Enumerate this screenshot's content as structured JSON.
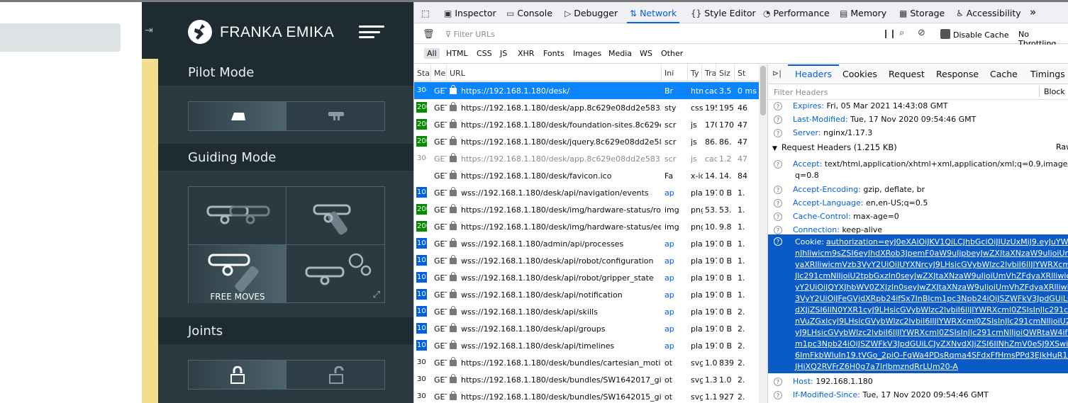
{
  "brand": {
    "name": "FRANKA EMIKA"
  },
  "desk": {
    "sections": [
      {
        "title": "Pilot Mode"
      },
      {
        "title": "Guiding Mode"
      },
      {
        "title": "Joints"
      }
    ],
    "guiding": {
      "selected_label": "FREE MOVES"
    }
  },
  "devtools": {
    "tabs": [
      {
        "label": "Inspector",
        "icon": "inspector-icon"
      },
      {
        "label": "Console",
        "icon": "console-icon"
      },
      {
        "label": "Debugger",
        "icon": "debugger-icon"
      },
      {
        "label": "Network",
        "icon": "network-icon"
      },
      {
        "label": "Style Editor",
        "icon": "style-editor-icon"
      },
      {
        "label": "Performance",
        "icon": "performance-icon"
      },
      {
        "label": "Memory",
        "icon": "memory-icon"
      },
      {
        "label": "Storage",
        "icon": "storage-icon"
      },
      {
        "label": "Accessibility",
        "icon": "accessibility-icon"
      }
    ],
    "active_tab": "Network",
    "filter_placeholder": "Filter URLs",
    "disable_cache": "Disable Cache",
    "throttling": "No Throttling",
    "types": [
      "All",
      "HTML",
      "CSS",
      "JS",
      "XHR",
      "Fonts",
      "Images",
      "Media",
      "WS",
      "Other"
    ],
    "columns": [
      "Sta",
      "Me",
      "URL",
      "Ini",
      "Ty",
      "Tra",
      "Siz",
      "St"
    ],
    "requests": [
      {
        "status": "304",
        "method": "GET",
        "url": "https://192.168.1.180/desk/",
        "init": "Br",
        "type": "htm",
        "transfer": "cac",
        "size": "3.5",
        "time": "0 ms"
      },
      {
        "status": "200",
        "method": "GET",
        "url": "https://192.168.1.180/desk/app.8c629e08dd2e58329...",
        "init": "sty",
        "type": "css",
        "transfer": "195",
        "size": "195",
        "time": "46"
      },
      {
        "status": "200",
        "method": "GET",
        "url": "https://192.168.1.180/desk/foundation-sites.8c629e0...",
        "init": "scr",
        "type": "js",
        "transfer": "170",
        "size": "170",
        "time": "47"
      },
      {
        "status": "200",
        "method": "GET",
        "url": "https://192.168.1.180/desk/jquery.8c629e08dd2e583...",
        "init": "scr",
        "type": "js",
        "transfer": "86.",
        "size": "86.",
        "time": "47"
      },
      {
        "status": "304",
        "method": "GET",
        "url": "https://192.168.1.180/desk/app.8c629e08dd2e58329...",
        "init": "scr",
        "type": "js",
        "transfer": "cac",
        "size": "1.2",
        "time": "47"
      },
      {
        "status": "",
        "method": "GET",
        "url": "https://192.168.1.180/desk/favicon.ico",
        "init": "Fa",
        "type": "x-ic",
        "transfer": "14.",
        "size": "14.",
        "time": "84"
      },
      {
        "status": "101",
        "method": "GET",
        "url": "wss://192.168.1.180/desk/api/navigation/events",
        "init": "ap",
        "type": "pla",
        "transfer": "197",
        "size": "0 B",
        "time": "1."
      },
      {
        "status": "200",
        "method": "GET",
        "url": "https://192.168.1.180/desk/img/hardware-status/rob...",
        "init": "img",
        "type": "png",
        "transfer": "53.",
        "size": "53.",
        "time": "1."
      },
      {
        "status": "200",
        "method": "GET",
        "url": "https://192.168.1.180/desk/img/hardware-status/ee-...",
        "init": "img",
        "type": "png",
        "transfer": "10.",
        "size": "9.8",
        "time": "1."
      },
      {
        "status": "101",
        "method": "GET",
        "url": "wss://192.168.1.180/admin/api/processes",
        "init": "ap",
        "type": "pla",
        "transfer": "197",
        "size": "0 B",
        "time": "1."
      },
      {
        "status": "101",
        "method": "GET",
        "url": "wss://192.168.1.180/desk/api/robot/configuration",
        "init": "ap",
        "type": "pla",
        "transfer": "197",
        "size": "0 B",
        "time": "1."
      },
      {
        "status": "101",
        "method": "GET",
        "url": "wss://192.168.1.180/desk/api/robot/gripper_state",
        "init": "ap",
        "type": "pla",
        "transfer": "197",
        "size": "0 B",
        "time": "1."
      },
      {
        "status": "101",
        "method": "GET",
        "url": "wss://192.168.1.180/desk/api/notification",
        "init": "ap",
        "type": "pla",
        "transfer": "197",
        "size": "0 B",
        "time": "1."
      },
      {
        "status": "101",
        "method": "GET",
        "url": "wss://192.168.1.180/desk/api/skills",
        "init": "ap",
        "type": "pla",
        "transfer": "197",
        "size": "0 B",
        "time": "2."
      },
      {
        "status": "101",
        "method": "GET",
        "url": "wss://192.168.1.180/desk/api/groups",
        "init": "ap",
        "type": "pla",
        "transfer": "197",
        "size": "0 B",
        "time": "2."
      },
      {
        "status": "101",
        "method": "GET",
        "url": "wss://192.168.1.180/desk/api/timelines",
        "init": "ap",
        "type": "pla",
        "transfer": "197",
        "size": "0 B",
        "time": "2."
      },
      {
        "status": "307",
        "method": "GET",
        "url": "https://192.168.1.180/desk/bundles/cartesian_motio...",
        "init": "ot",
        "type": "svg",
        "transfer": "1.0",
        "size": "839",
        "time": "2."
      },
      {
        "status": "307",
        "method": "GET",
        "url": "https://192.168.1.180/desk/bundles/SW1642017_gim...",
        "init": "ot",
        "type": "svg",
        "transfer": "1.3",
        "size": "1.0",
        "time": "2."
      },
      {
        "status": "307",
        "method": "GET",
        "url": "https://192.168.1.180/desk/bundles/SW1642015_gim...",
        "init": "ot",
        "type": "svg",
        "transfer": "1.1",
        "size": "927",
        "time": "2."
      }
    ],
    "panel_tabs": [
      "Headers",
      "Cookies",
      "Request",
      "Response",
      "Cache",
      "Timings"
    ],
    "filter_headers": "Filter Headers",
    "block": "Block",
    "raw": "Raw",
    "response_headers": [
      {
        "key": "Expires:",
        "value": "Fri, 05 Mar 2021 14:43:08 GMT"
      },
      {
        "key": "Last-Modified:",
        "value": "Tue, 17 Nov 2020 09:54:46 GMT"
      },
      {
        "key": "Server:",
        "value": "nginx/1.17.3"
      }
    ],
    "request_headers_title": "Request Headers (1.215 KB)",
    "request_headers": [
      {
        "key": "Accept:",
        "value": "text/html,application/xhtml+xml,application/xml;q=0.9,image/webp,",
        "cont": "q=0.8"
      },
      {
        "key": "Accept-Encoding:",
        "value": "gzip, deflate, br"
      },
      {
        "key": "Accept-Language:",
        "value": "en,en-US;q=0.5"
      },
      {
        "key": "Cache-Control:",
        "value": "max-age=0"
      },
      {
        "key": "Connection:",
        "value": "keep-alive"
      }
    ],
    "cookie_key": "Cookie:",
    "cookie_lines": [
      "authorization=eyJ0eXAiOiJKV1QiLCJhbGciOiJIUzUxMiJ9.eyJuYW1lIj",
      "nJhliwicm9sZSI6eyJhdXRob3JpemF0aW9uIjpbeyJwZXJtaXNzaW9uIjoiUmVhZ",
      "yaXRlliwicmVzb3VyY2UiOiJUYXNrcyJ9LHsicGVybWlzc2lvbiI6IlJlYWRXcml0ZS",
      "Jlc291cmNlIjoiU2tpbGxzIn0seyJwZXJtaXNzaW9uIjoiUmVhZFdyaXRlliwicmVzb",
      "yY2UiOiJQYXJhbWV0ZXJzIn0seyJwZXJtaXNzaW9uIjoiUmVhZFdyaXRlliwicmV",
      "3VyY2UiOiJFeGVjdXRpb24ifSx7InBlcm1pc3Npb24iOiJSZWFkV3JpdGUiLCJyZ",
      "dXJjZSI6IlN0YXR1cyJ9LHsicGVybWlzc2lvbiI6IlJlYWRXcml0ZSIsInJlc291cmNlIj",
      "nVuZGxlcyJ9LHsicGVybWlzc2lvbiI6IlJlYWRXcml0ZSIsInJlc291cmNlIjoiU2NyaX",
      "yJ9LHsicGVybWlzc2lvbiI6IlJlYWRXcml0ZSIsInJlc291cmNlIjoiQWRtaW4ifSx7In",
      "m1pc3Npb24iOiJSZWFkV3JpdGUiLCJyZXNvdXJjZSI6IlNhZmV0eSJ9XSwibmFt",
      "6ImFkbWluIn19.tVGo_2piO-FgWa4PDsRqma4SFdxFfHmsPPd3EJkHuR12-OFP",
      "JHiXQ2RVFrZ6H0g7a7IrlbmzndRrLUm20-A"
    ],
    "after_headers": [
      {
        "key": "Host:",
        "value": "192.168.1.180"
      },
      {
        "key": "If-Modified-Since:",
        "value": "Tue, 17 Nov 2020 09:54:46 GMT"
      }
    ]
  }
}
